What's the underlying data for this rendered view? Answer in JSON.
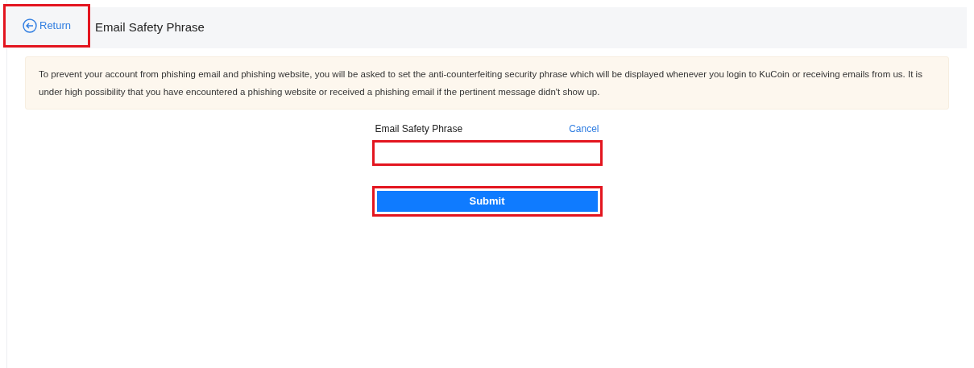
{
  "header": {
    "return_button": {
      "label": "Return",
      "highlighted": true
    },
    "title": "Email Safety Phrase"
  },
  "notice": "To prevent your account from phishing email and phishing website, you will be asked to set the anti-counterfeiting security phrase which will be displayed whenever you login to KuCoin or receiving emails from us. It is under high possibility that you have encountered a phishing website or received a phishing email if the pertinent message didn't show up.",
  "form": {
    "label": "Email Safety Phrase",
    "cancel": "Cancel",
    "field_highlighted": true,
    "submit": {
      "label": "Submit",
      "highlighted": true
    }
  }
}
